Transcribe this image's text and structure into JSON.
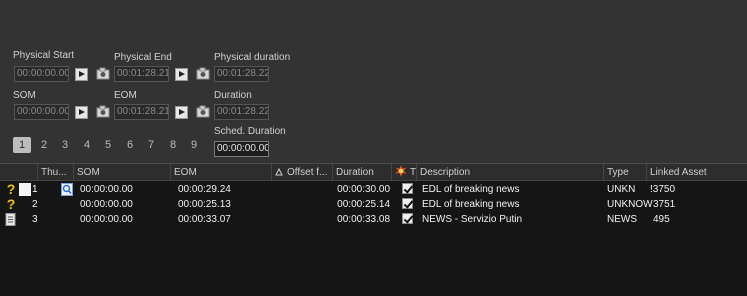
{
  "labels": {
    "physical_start": "Physical Start",
    "physical_end": "Physical End",
    "physical_duration": "Physical duration",
    "som": "SOM",
    "eom": "EOM",
    "duration": "Duration",
    "sched_duration": "Sched. Duration"
  },
  "values": {
    "physical_start": "00:00:00.00",
    "physical_end": "00:01:28.21",
    "physical_duration": "00:01:28.22",
    "som": "00:00:00.00",
    "eom": "00:01:28.21",
    "duration": "00:01:28.22",
    "sched_duration": "00:00:00.00"
  },
  "pager": {
    "pages": [
      "1",
      "2",
      "3",
      "4",
      "5",
      "6",
      "7",
      "8",
      "9"
    ],
    "selected": "1"
  },
  "grid": {
    "columns": {
      "thumb": "Thu...",
      "som": "SOM",
      "eom": "EOM",
      "offset": "Offset f...",
      "duration": "Duration",
      "t": "T",
      "description": "Description",
      "type": "Type",
      "linked_asset": "Linked Asset"
    },
    "rows": [
      {
        "index": "1",
        "som": "00:00:00.00",
        "eom": "00:00:29.24",
        "duration": "00:00:30.00",
        "checked": true,
        "description": "EDL of breaking news",
        "type": "UNKN",
        "linked": "!3750",
        "status_icon": "question-icon"
      },
      {
        "index": "2",
        "som": "00:00:00.00",
        "eom": "00:00:25.13",
        "duration": "00:00:25.14",
        "checked": true,
        "description": "EDL of breaking news",
        "type": "UNKNOW",
        "linked": "3751",
        "status_icon": "question-icon"
      },
      {
        "index": "3",
        "som": "00:00:00.00",
        "eom": "00:00:33.07",
        "duration": "00:00:33.08",
        "checked": true,
        "description": "NEWS - Servizio Putin",
        "type": "NEWS",
        "linked": "495",
        "status_icon": "document-icon"
      }
    ]
  }
}
